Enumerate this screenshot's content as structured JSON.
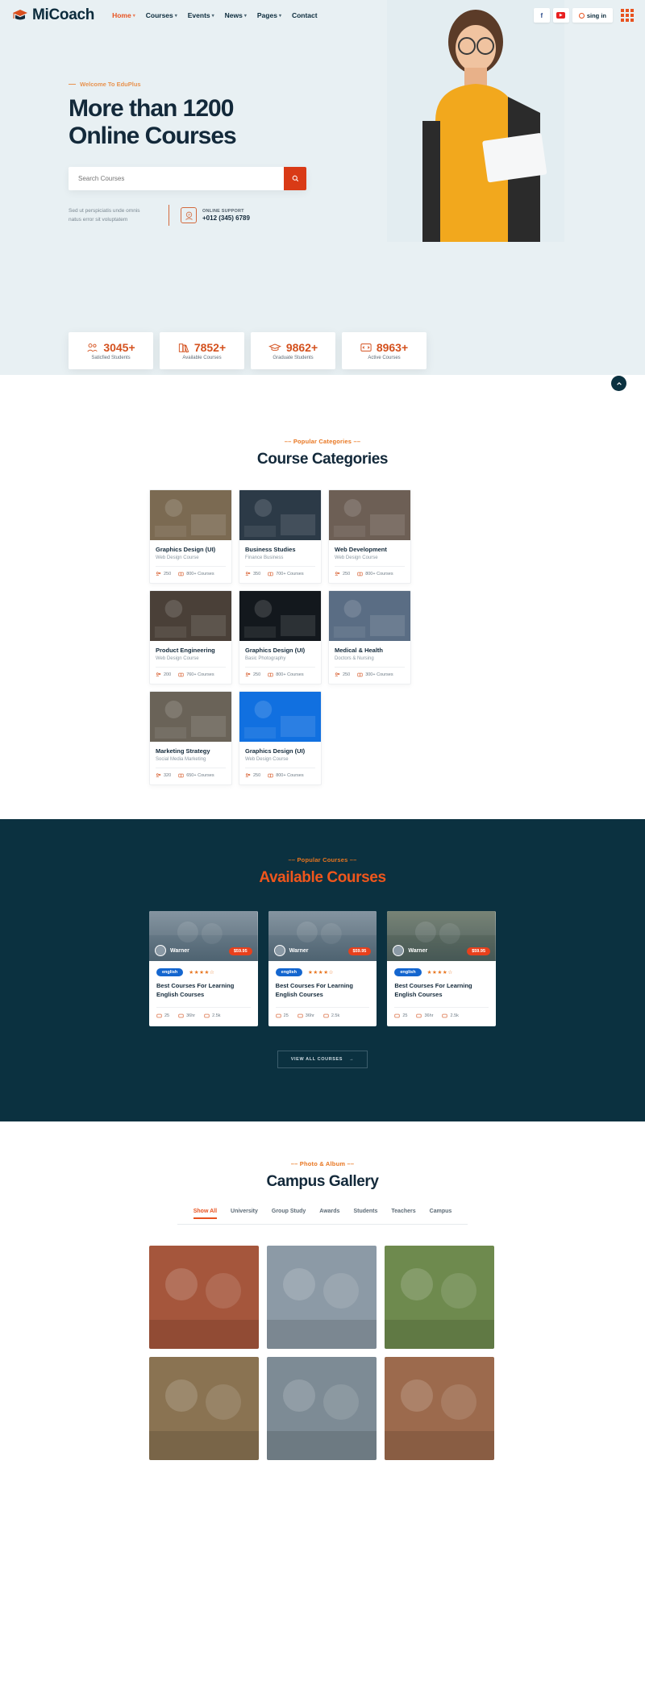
{
  "brand": {
    "name_first": "Mi",
    "name_second": "Coach",
    "icon": "graduation-cap-icon"
  },
  "nav": {
    "items": [
      {
        "label": "Home",
        "has_caret": true,
        "active": true
      },
      {
        "label": "Courses",
        "has_caret": true,
        "active": false
      },
      {
        "label": "Events",
        "has_caret": true,
        "active": false
      },
      {
        "label": "News",
        "has_caret": true,
        "active": false
      },
      {
        "label": "Pages",
        "has_caret": true,
        "active": false
      },
      {
        "label": "Contact",
        "has_caret": false,
        "active": false
      }
    ],
    "facebook_icon": "facebook-icon",
    "youtube_icon": "youtube-icon",
    "signin_label": "sing in",
    "signin_icon": "user-circle-icon",
    "grid_menu_icon": "grid-menu-icon"
  },
  "hero": {
    "eyebrow": "Welcome To EduPlus",
    "title_line1": "More than 1200",
    "title_line2": "Online Courses",
    "search_placeholder": "Search Courses",
    "search_icon": "search-icon",
    "lorem_line1": "Sed ut perspiciatis unde omnis",
    "lorem_line2": "natus error sit voluptatem",
    "support_icon": "support-24-icon",
    "support_label": "ONLINE SUPPORT",
    "support_phone": "+012 (345) 6789"
  },
  "stats": [
    {
      "icon": "people-group-icon",
      "number": "3045+",
      "label": "Saticfied Students"
    },
    {
      "icon": "books-icon",
      "number": "7852+",
      "label": "Available Courses"
    },
    {
      "icon": "graduation-cap-icon",
      "number": "9862+",
      "label": "Graduate Students"
    },
    {
      "icon": "code-brackets-icon",
      "number": "8963+",
      "label": "Active Courses"
    }
  ],
  "categories_section": {
    "eyebrow": "Popular Categories",
    "title": "Course Categories",
    "cards": [
      {
        "title": "Graphics Design (UI)",
        "sub": "Web Design Course",
        "students": "250",
        "courses": "800+ Courses",
        "img": "#7b6a52"
      },
      {
        "title": "Business Studies",
        "sub": "Finance Business",
        "students": "350",
        "courses": "700+ Courses",
        "img": "#2c3a47"
      },
      {
        "title": "Web Development",
        "sub": "Web Design Course",
        "students": "250",
        "courses": "800+ Courses",
        "img": "#6d5f55"
      },
      {
        "title": "Product Engineering",
        "sub": "Web Design Course",
        "students": "200",
        "courses": "760+ Courses",
        "img": "#4a4038"
      },
      {
        "title": "Graphics Design (UI)",
        "sub": "Basic Photography",
        "students": "250",
        "courses": "800+ Courses",
        "img": "#13181d"
      },
      {
        "title": "Medical & Health",
        "sub": "Doctors & Nursing",
        "students": "250",
        "courses": "300+ Courses",
        "img": "#5a6d84"
      },
      {
        "title": "Marketing Strategy",
        "sub": "Social Media Marketing",
        "students": "320",
        "courses": "650+ Courses",
        "img": "#6a6358"
      },
      {
        "title": "Graphics Design (UI)",
        "sub": "Web Design Course",
        "students": "250",
        "courses": "800+ Courses",
        "img": "#1170e0"
      }
    ]
  },
  "courses_section": {
    "eyebrow": "Popular Courses",
    "title": "Available Courses",
    "view_all_label": "VIEW ALL COURSES",
    "view_all_icon": "arrow-right-icon",
    "cards": [
      {
        "author": "Warner",
        "price": "$59.95",
        "lang": "english",
        "stars": "★★★★☆",
        "name": "Best Courses For Learning English Courses",
        "meta": [
          {
            "icon": "user-icon",
            "value": "25"
          },
          {
            "icon": "clock-icon",
            "value": "36hr"
          },
          {
            "icon": "book-icon",
            "value": "2.5k"
          }
        ],
        "img": "#7e8f9c"
      },
      {
        "author": "Warner",
        "price": "$59.95",
        "lang": "english",
        "stars": "★★★★☆",
        "name": "Best Courses For Learning English Courses",
        "meta": [
          {
            "icon": "user-icon",
            "value": "25"
          },
          {
            "icon": "clock-icon",
            "value": "36hr"
          },
          {
            "icon": "book-icon",
            "value": "2.5k"
          }
        ],
        "img": "#7e8f9c"
      },
      {
        "author": "Warner",
        "price": "$59.95",
        "lang": "english",
        "stars": "★★★★☆",
        "name": "Best Courses For Learning English Courses",
        "meta": [
          {
            "icon": "user-icon",
            "value": "25"
          },
          {
            "icon": "clock-icon",
            "value": "36hr"
          },
          {
            "icon": "book-icon",
            "value": "2.5k"
          }
        ],
        "img": "#6f7b6a"
      }
    ]
  },
  "gallery_section": {
    "eyebrow": "Photo & Album",
    "title": "Campus Gallery",
    "tabs": [
      {
        "label": "Show All",
        "active": true
      },
      {
        "label": "University",
        "active": false
      },
      {
        "label": "Group Study",
        "active": false
      },
      {
        "label": "Awards",
        "active": false
      },
      {
        "label": "Students",
        "active": false
      },
      {
        "label": "Teachers",
        "active": false
      },
      {
        "label": "Campus",
        "active": false
      }
    ],
    "items": [
      {
        "img": "#a5563c"
      },
      {
        "img": "#8c9aa6"
      },
      {
        "img": "#6e8a4e"
      },
      {
        "img": "#8a7352"
      },
      {
        "img": "#7d8b95"
      },
      {
        "img": "#9c6a4d"
      }
    ]
  },
  "scroll_top": {
    "icon": "chevron-up-icon"
  },
  "colors": {
    "accent": "#e8521f",
    "dark": "#0b3140",
    "navy": "#13293a",
    "orange": "#d4511e"
  }
}
